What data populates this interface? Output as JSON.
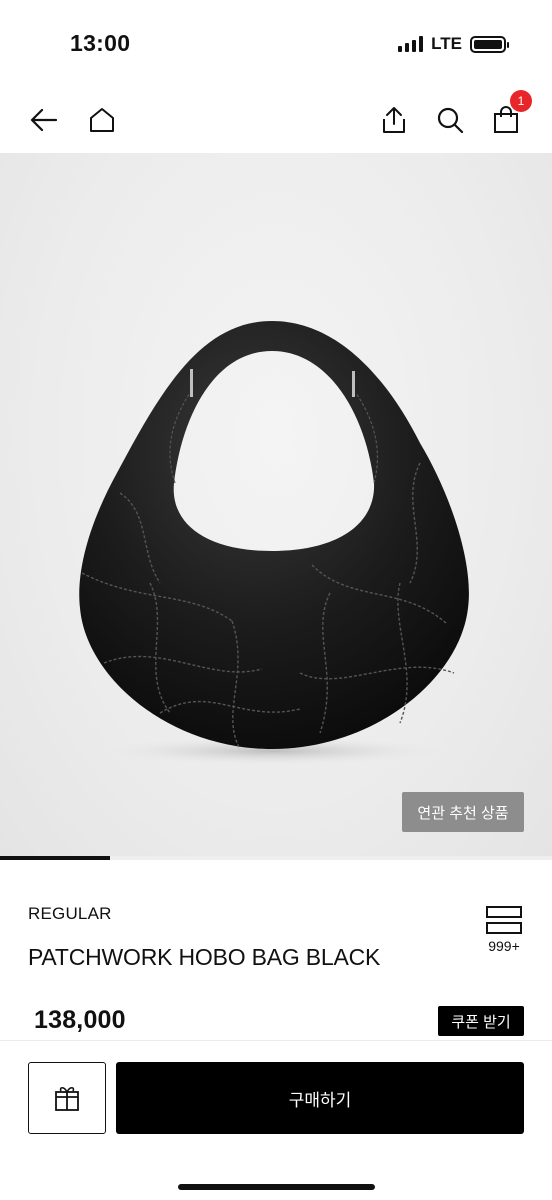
{
  "status_bar": {
    "time": "13:00",
    "network": "LTE",
    "icons": [
      "signal-icon",
      "battery-icon"
    ]
  },
  "nav": {
    "icons": [
      "back-arrow-icon",
      "home-icon",
      "share-icon",
      "search-icon",
      "cart-icon"
    ],
    "cart_badge": "1",
    "badge_color": "#e8262a"
  },
  "gallery": {
    "image": "bag-image",
    "related_label": "연관 추천 상품",
    "progress": 0.2
  },
  "product": {
    "brand": "REGULAR",
    "name": "PATCHWORK HOBO BAG BLACK",
    "like_count": "999+",
    "price": "138,000",
    "coupon_label": "쿠폰 받기"
  },
  "actions": {
    "gift_icon": "gift-icon",
    "buy_label": "구매하기"
  }
}
